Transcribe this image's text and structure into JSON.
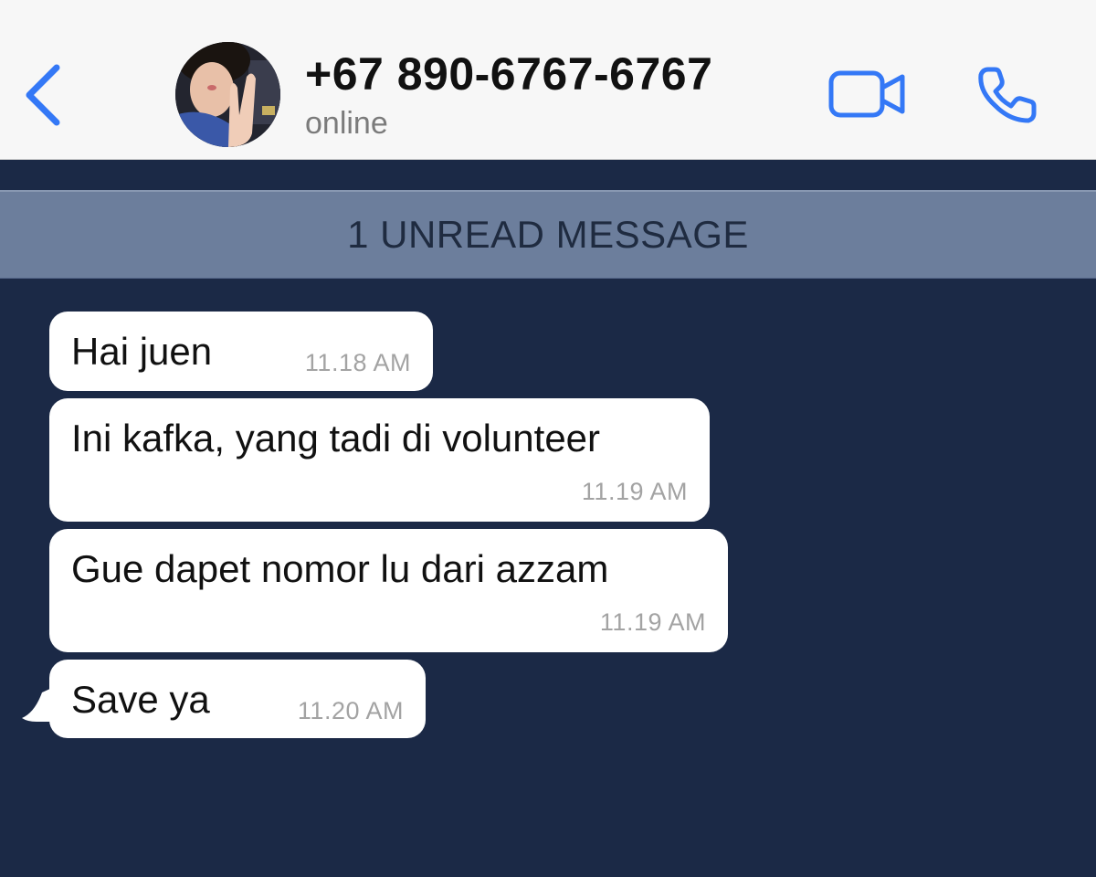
{
  "header": {
    "contact_name": "+67 890-6767-6767",
    "status": "online",
    "back_icon": "chevron-left-icon",
    "video_icon": "video-camera-icon",
    "call_icon": "phone-icon"
  },
  "unread_banner": "1 UNREAD MESSAGE",
  "messages": [
    {
      "text": "Hai juen",
      "time": "11.18 AM"
    },
    {
      "text": "Ini kafka, yang tadi di volunteer",
      "time": "11.19 AM"
    },
    {
      "text": "Gue dapet nomor lu dari azzam",
      "time": "11.19 AM"
    },
    {
      "text": "Save ya",
      "time": "11.20 AM"
    }
  ],
  "colors": {
    "accent": "#3478f6",
    "chat_background": "#1b2946",
    "banner": "#6c7e9c",
    "bubble": "#ffffff",
    "timestamp": "#a3a3a3"
  }
}
